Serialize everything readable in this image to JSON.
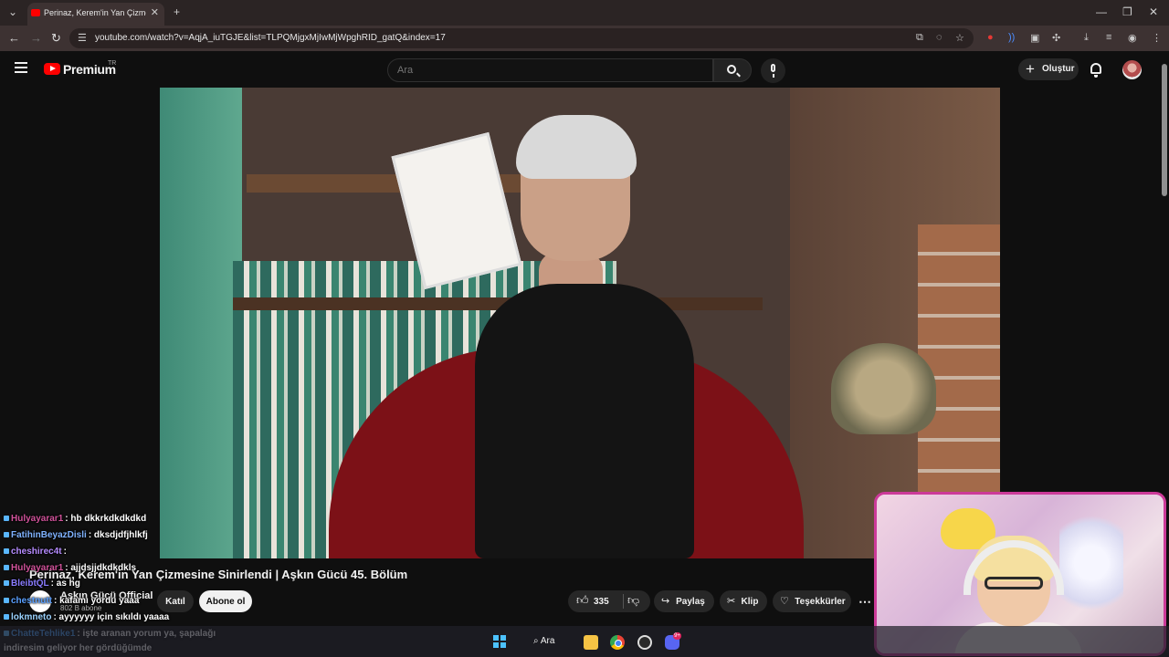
{
  "browser": {
    "tab_title": "Perinaz, Kerem'in Yan Çizmesine...",
    "url": "youtube.com/watch?v=AqjA_iuTGJE&list=TLPQMjgxMjIwMjWpghRID_gatQ&index=17"
  },
  "youtube": {
    "brand": "Premium",
    "region": "TR",
    "search_placeholder": "Ara",
    "create_label": "Oluştur"
  },
  "video": {
    "title": "Perinaz, Kerem'in Yan Çizmesine Sinirlendi | Aşkın Gücü 45. Bölüm",
    "channel_name": "Aşkın Gücü Official",
    "subscribers": "802 B abone",
    "join_label": "Katıl",
    "subscribe_label": "Abone ol",
    "likes": "335",
    "share_label": "Paylaş",
    "clip_label": "Klip",
    "thanks_label": "Teşekkürler"
  },
  "chat": [
    {
      "user": "Hulyayarar1",
      "text": ": hb dkkrkdkdkdkd",
      "color": "#d1529a"
    },
    {
      "user": "FatihinBeyazDisli",
      "text": ": dksdjdfjhlkfj",
      "color": "#7fb2ff"
    },
    {
      "user": "cheshirec4t",
      "text": ":",
      "color": "#b68cff"
    },
    {
      "user": "Hulyayarar1",
      "text": ": ajjdsjjdkdkdkls",
      "color": "#d1529a"
    },
    {
      "user": "BleibtQL",
      "text": ": as hg",
      "color": "#8a7cff"
    },
    {
      "user": "chestnutt",
      "text": ": kafamı yordu yaaa",
      "color": "#5aa0ff"
    },
    {
      "user": "lokmneto",
      "text": ": ayyyyyy için sıkıldı yaaaa",
      "color": "#9bd3ff"
    },
    {
      "user": "ChatteTehlike1",
      "text": ": işte aranan yorum ya, şapalağı",
      "color": "#4aa3ff"
    },
    {
      "user": "",
      "text": "indiresim geliyor her gördüğümde",
      "color": "#ffffff"
    }
  ],
  "taskbar": {
    "search_label": "Ara",
    "discord_badge": "9+"
  },
  "colors": {
    "youtube_red": "#ff0000",
    "cam_border": "#cc3a99"
  }
}
